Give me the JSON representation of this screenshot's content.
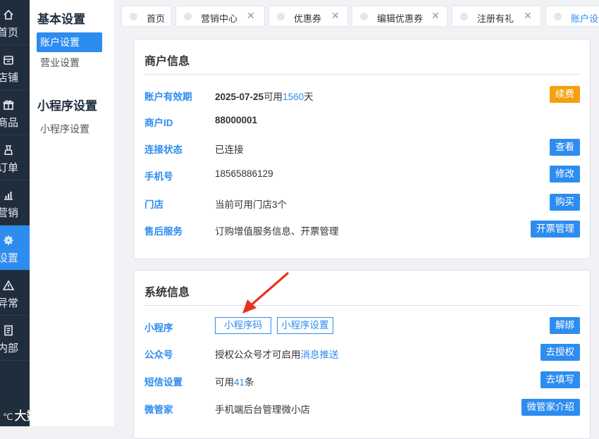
{
  "left_nav": {
    "items": [
      {
        "label": "首页",
        "icon": "home-icon"
      },
      {
        "label": "店铺",
        "icon": "store-icon"
      },
      {
        "label": "商品",
        "icon": "gift-icon"
      },
      {
        "label": "订单",
        "icon": "order-icon"
      },
      {
        "label": "营销",
        "icon": "chart-icon"
      },
      {
        "label": "设置",
        "icon": "gear-icon"
      },
      {
        "label": "异常",
        "icon": "warning-icon"
      },
      {
        "label": "内部",
        "icon": "document-icon"
      }
    ],
    "active_index": 5,
    "accent_color": "#2d8cf0",
    "background_color": "#1f2d3d"
  },
  "watermark": {
    "text": "大数跨境"
  },
  "sub_nav": {
    "groups": [
      {
        "title": "基本设置",
        "items": [
          "账户设置",
          "营业设置"
        ]
      },
      {
        "title": "小程序设置",
        "items": [
          "小程序设置"
        ]
      }
    ],
    "active_item": "账户设置"
  },
  "tabs": [
    {
      "label": "首页",
      "closable": false
    },
    {
      "label": "营销中心",
      "closable": true
    },
    {
      "label": "优惠券",
      "closable": true
    },
    {
      "label": "编辑优惠券",
      "closable": true
    },
    {
      "label": "注册有礼",
      "closable": true
    },
    {
      "label": "账户设置",
      "closable": true
    }
  ],
  "merchant_info": {
    "title": "商户信息",
    "rows": {
      "validity": {
        "label": "账户有效期",
        "date": "2025-07-25",
        "prefix": "可用",
        "days": "1560",
        "suffix": "天",
        "button": "续费"
      },
      "merchant_id": {
        "label": "商户ID",
        "value": "88000001"
      },
      "connection": {
        "label": "连接状态",
        "value": "已连接",
        "button": "查看"
      },
      "phone": {
        "label": "手机号",
        "value": "18565886129",
        "button": "修改"
      },
      "store": {
        "label": "门店",
        "value": "当前可用门店3个",
        "button": "购买"
      },
      "after_sales": {
        "label": "售后服务",
        "value": "订购增值服务信息、开票管理",
        "button": "开票管理"
      }
    }
  },
  "system_info": {
    "title": "系统信息",
    "rows": {
      "mini_program": {
        "label": "小程序",
        "outline_buttons": [
          "小程序码",
          "小程序设置"
        ],
        "button": "解绑"
      },
      "official_account": {
        "label": "公众号",
        "prefix": "授权公众号才可启用",
        "link": "消息推送",
        "button": "去授权"
      },
      "sms": {
        "label": "短信设置",
        "prefix": "可用",
        "count": "41",
        "suffix": "条",
        "button": "去填写"
      },
      "steward": {
        "label": "微管家",
        "value": "手机端后台管理微小店",
        "button": "微管家介绍"
      }
    }
  },
  "colors": {
    "primary": "#2d8cf0",
    "warning": "#f5a10f",
    "annotation_arrow": "#e8321e"
  }
}
